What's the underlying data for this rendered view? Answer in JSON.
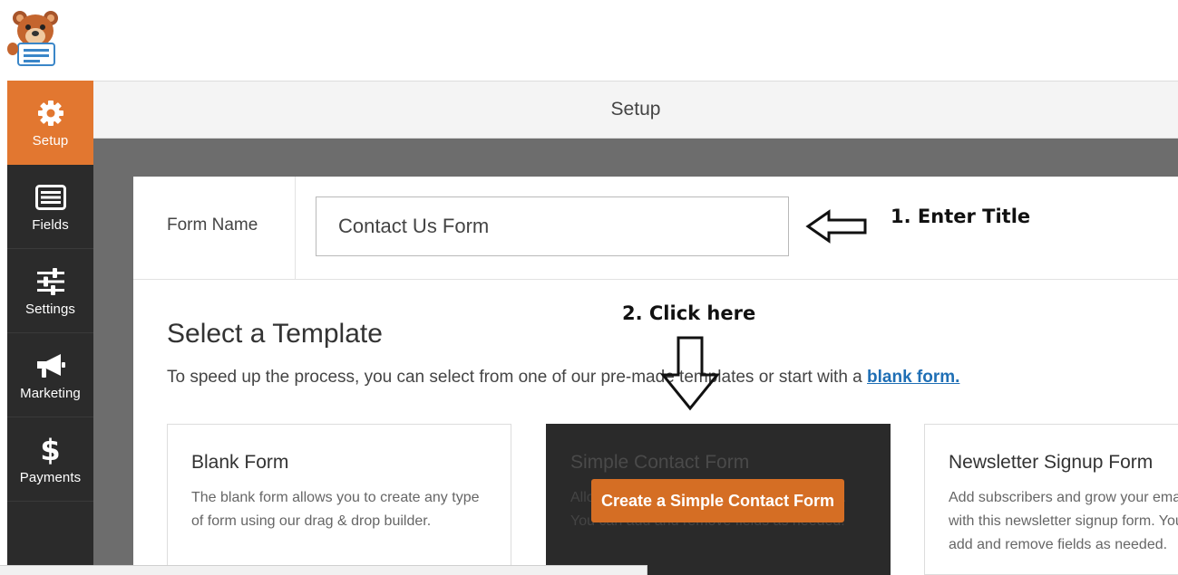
{
  "header": {
    "title": "Setup"
  },
  "sidebar": {
    "items": [
      {
        "label": "Setup",
        "icon": "gear-icon"
      },
      {
        "label": "Fields",
        "icon": "list-icon"
      },
      {
        "label": "Settings",
        "icon": "sliders-icon"
      },
      {
        "label": "Marketing",
        "icon": "megaphone-icon"
      },
      {
        "label": "Payments",
        "icon": "dollar-icon"
      }
    ]
  },
  "form_name": {
    "label": "Form Name",
    "value": "Contact Us Form"
  },
  "annotations": {
    "step1": "1. Enter Title",
    "step2": "2. Click here"
  },
  "templates": {
    "heading": "Select a Template",
    "description": "To speed up the process, you can select from one of our pre-made templates or start with a",
    "blank_link": "blank form.",
    "cards": [
      {
        "title": "Blank Form",
        "description": "The blank form allows you to create any type of form using our drag & drop builder."
      },
      {
        "title": "Simple Contact Form",
        "description": "Allows you to create a simple contact form. You can add and remove fields as needed.",
        "button": "Create a Simple Contact Form"
      },
      {
        "title": "Newsletter Signup Form",
        "description": "Add subscribers and grow your email list with this newsletter signup form. You can add and remove fields as needed."
      }
    ]
  },
  "colors": {
    "accent": "#e27730",
    "button": "#d56e24",
    "sidebar": "#2b2b2b",
    "link": "#1f6fb5"
  }
}
